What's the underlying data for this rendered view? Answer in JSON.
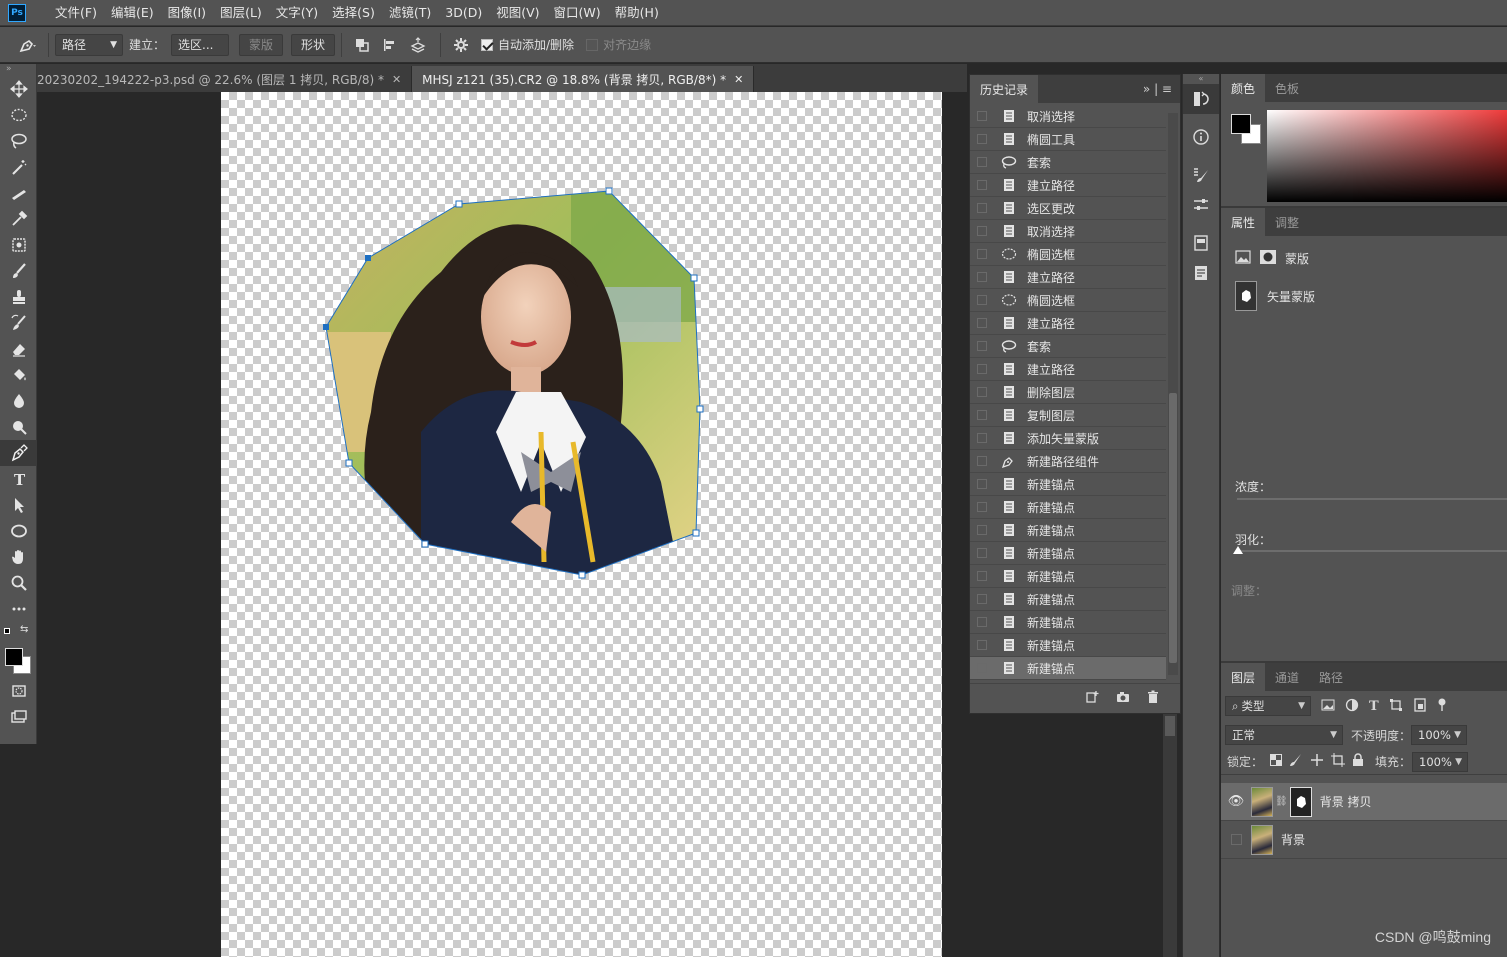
{
  "app": {
    "logo": "Ps"
  },
  "menu": [
    "文件(F)",
    "编辑(E)",
    "图像(I)",
    "图层(L)",
    "文字(Y)",
    "选择(S)",
    "滤镜(T)",
    "3D(D)",
    "视图(V)",
    "窗口(W)",
    "帮助(H)"
  ],
  "options": {
    "mode": "路径",
    "build_label": "建立：",
    "selection_btn": "选区...",
    "mask_btn": "蒙版",
    "shape_btn": "形状",
    "auto_add_delete": "自动添加/删除",
    "auto_add_checked": true,
    "align_edges": "对齐边缘",
    "align_edges_checked": false
  },
  "doc_tabs": [
    {
      "title": "20230202_194222-p3.psd @ 22.6% (图层 1 拷贝, RGB/8) *",
      "active": false
    },
    {
      "title": "MHSJ z121 (35).CR2 @ 18.8% (背景 拷贝, RGB/8*) *",
      "active": true
    }
  ],
  "history": {
    "tab": "历史记录",
    "items": [
      {
        "label": "取消选择",
        "icon": "doc-icon"
      },
      {
        "label": "椭圆工具",
        "icon": "doc-icon"
      },
      {
        "label": "套索",
        "icon": "lasso-icon"
      },
      {
        "label": "建立路径",
        "icon": "doc-icon"
      },
      {
        "label": "选区更改",
        "icon": "doc-icon"
      },
      {
        "label": "取消选择",
        "icon": "doc-icon"
      },
      {
        "label": "椭圆选框",
        "icon": "ellipse-icon"
      },
      {
        "label": "建立路径",
        "icon": "doc-icon"
      },
      {
        "label": "椭圆选框",
        "icon": "ellipse-icon"
      },
      {
        "label": "建立路径",
        "icon": "doc-icon"
      },
      {
        "label": "套索",
        "icon": "lasso-icon"
      },
      {
        "label": "建立路径",
        "icon": "doc-icon"
      },
      {
        "label": "删除图层",
        "icon": "doc-icon"
      },
      {
        "label": "复制图层",
        "icon": "doc-icon"
      },
      {
        "label": "添加矢量蒙版",
        "icon": "doc-icon"
      },
      {
        "label": "新建路径组件",
        "icon": "pen-icon"
      },
      {
        "label": "新建锚点",
        "icon": "doc-icon"
      },
      {
        "label": "新建锚点",
        "icon": "doc-icon"
      },
      {
        "label": "新建锚点",
        "icon": "doc-icon"
      },
      {
        "label": "新建锚点",
        "icon": "doc-icon"
      },
      {
        "label": "新建锚点",
        "icon": "doc-icon"
      },
      {
        "label": "新建锚点",
        "icon": "doc-icon"
      },
      {
        "label": "新建锚点",
        "icon": "doc-icon"
      },
      {
        "label": "新建锚点",
        "icon": "doc-icon"
      },
      {
        "label": "新建锚点",
        "icon": "doc-icon"
      }
    ],
    "selected_index": 24
  },
  "color_panel": {
    "tabs": [
      "颜色",
      "色板"
    ],
    "active": 0,
    "foreground": "#000000",
    "background": "#ffffff"
  },
  "properties": {
    "tabs": [
      "属性",
      "调整"
    ],
    "active": 0,
    "type": "蒙版",
    "vector_mask": "矢量蒙版",
    "density": "浓度：",
    "feather": "羽化：",
    "adjust": "调整："
  },
  "layers": {
    "tabs": [
      "图层",
      "通道",
      "路径"
    ],
    "active": 0,
    "filter": "类型",
    "blend": "正常",
    "opacity_label": "不透明度：",
    "opacity": "100%",
    "lock_label": "锁定：",
    "fill_label": "填充：",
    "fill": "100%",
    "items": [
      {
        "name": "背景 拷贝",
        "visible": true,
        "selected": true,
        "has_mask": true
      },
      {
        "name": "背景",
        "visible": false,
        "selected": false,
        "has_mask": false
      }
    ]
  },
  "watermark": "CSDN @鸣鼓ming"
}
